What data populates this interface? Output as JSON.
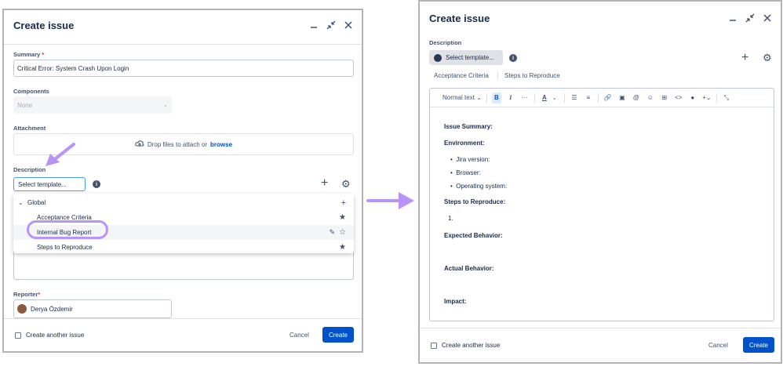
{
  "left": {
    "title": "Create issue",
    "summary_label": "Summary",
    "required_mark": "*",
    "summary_value": "Critical Error: System Crash Upon Login",
    "components_label": "Components",
    "components_value": "None",
    "attachment_label": "Attachment",
    "attach_text": "Drop files to attach or",
    "attach_link": "browse",
    "description_label": "Description",
    "template_select": "Select template...",
    "dropdown": {
      "group": "Global",
      "items": [
        "Acceptance Criteria",
        "Internal Bug Report",
        "Steps to Reproduce"
      ]
    },
    "reporter_label": "Reporter",
    "reporter_name": "Derya Özdemir",
    "create_another": "Create another issue",
    "cancel": "Cancel",
    "create": "Create"
  },
  "right": {
    "title": "Create issue",
    "description_label": "Description",
    "template_select": "Select template...",
    "quick_templates": [
      "Acceptance Criteria",
      "Steps to Reproduce"
    ],
    "toolbar": {
      "text_style": "Normal text",
      "bold": "B",
      "italic": "I",
      "more": "···",
      "text_color": "A"
    },
    "content": {
      "issue_summary": "Issue Summary:",
      "environment": "Environment:",
      "env_items": [
        "Jira version:",
        "Browser:",
        "Operating system:"
      ],
      "steps": "Steps to Reproduce:",
      "steps_first": "1.",
      "expected": "Expected Behavior:",
      "actual": "Actual Behavior:",
      "impact": "Impact:"
    },
    "create_another": "Create another issue",
    "cancel": "Cancel",
    "create": "Create"
  },
  "colors": {
    "primary": "#0052cc",
    "highlight": "#b794f6",
    "arrow": "#b794f6"
  }
}
